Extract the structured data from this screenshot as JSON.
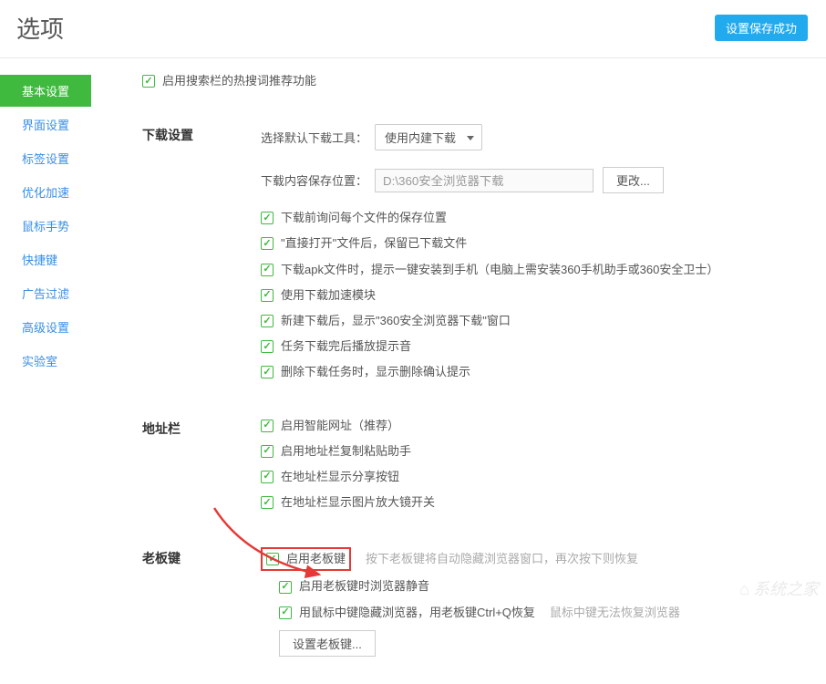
{
  "header": {
    "title": "选项",
    "save_badge": "设置保存成功"
  },
  "sidebar": {
    "items": [
      {
        "label": "基本设置",
        "active": true
      },
      {
        "label": "界面设置",
        "active": false
      },
      {
        "label": "标签设置",
        "active": false
      },
      {
        "label": "优化加速",
        "active": false
      },
      {
        "label": "鼠标手势",
        "active": false
      },
      {
        "label": "快捷键",
        "active": false
      },
      {
        "label": "广告过滤",
        "active": false
      },
      {
        "label": "高级设置",
        "active": false
      },
      {
        "label": "实验室",
        "active": false
      }
    ]
  },
  "top_checkbox": {
    "label": "启用搜索栏的热搜词推荐功能"
  },
  "download": {
    "section_title": "下载设置",
    "tool_label": "选择默认下载工具：",
    "tool_value": "使用内建下载",
    "path_label": "下载内容保存位置：",
    "path_value": "D:\\360安全浏览器下载",
    "change_btn": "更改...",
    "checks": [
      "下载前询问每个文件的保存位置",
      "\"直接打开\"文件后，保留已下载文件",
      "下载apk文件时，提示一键安装到手机（电脑上需安装360手机助手或360安全卫士）",
      "使用下载加速模块",
      "新建下载后，显示\"360安全浏览器下载\"窗口",
      "任务下载完后播放提示音",
      "删除下载任务时，显示删除确认提示"
    ]
  },
  "address": {
    "section_title": "地址栏",
    "checks": [
      "启用智能网址（推荐）",
      "启用地址栏复制粘贴助手",
      "在地址栏显示分享按钮",
      "在地址栏显示图片放大镜开关"
    ]
  },
  "boss": {
    "section_title": "老板键",
    "enable_label": "启用老板键",
    "enable_hint": "按下老板键将自动隐藏浏览器窗口，再次按下则恢复",
    "mute_label": "启用老板键时浏览器静音",
    "middle_label": "用鼠标中键隐藏浏览器，用老板键Ctrl+Q恢复",
    "middle_hint": "鼠标中键无法恢复浏览器",
    "set_btn": "设置老板键..."
  },
  "watermark": "系统之家"
}
